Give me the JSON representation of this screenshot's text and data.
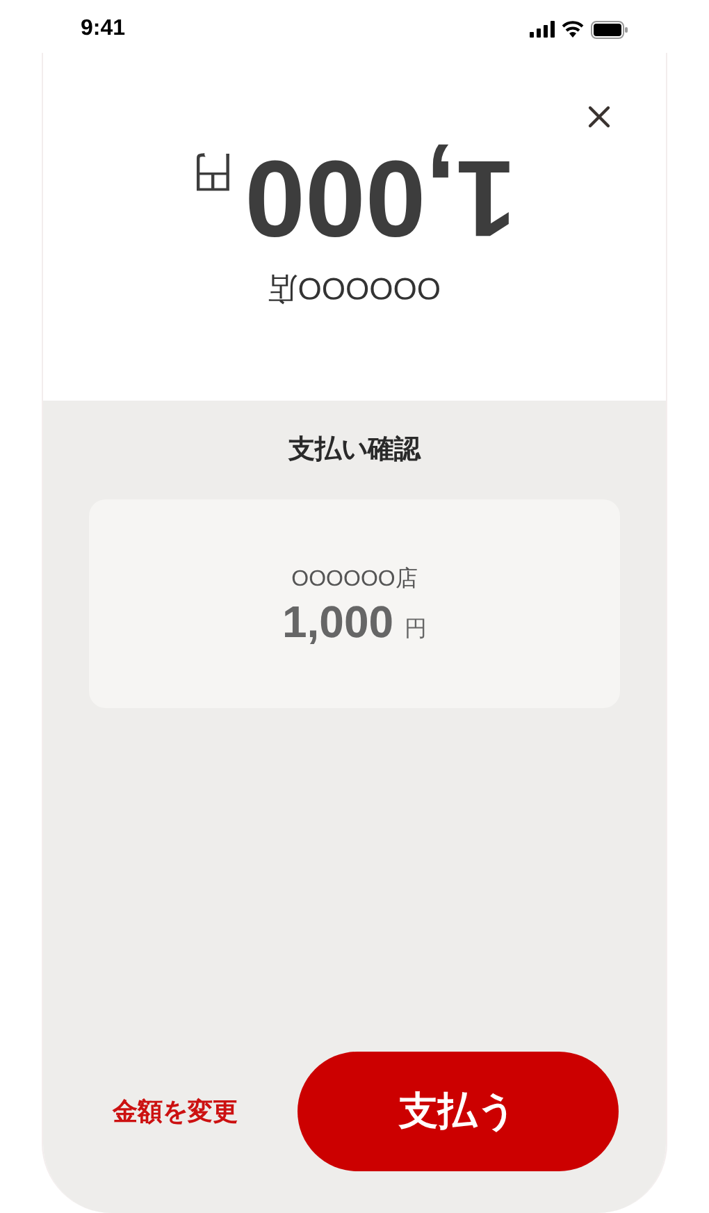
{
  "status_bar": {
    "time": "9:41"
  },
  "header": {
    "inverted": true,
    "store": "OOOOOO店",
    "amount": "1,000",
    "currency": "円"
  },
  "title": "支払い確認",
  "card": {
    "store": "OOOOOO店",
    "amount": "1,000",
    "currency": "円"
  },
  "actions": {
    "change_amount": "金額を変更",
    "pay": "支払う"
  }
}
